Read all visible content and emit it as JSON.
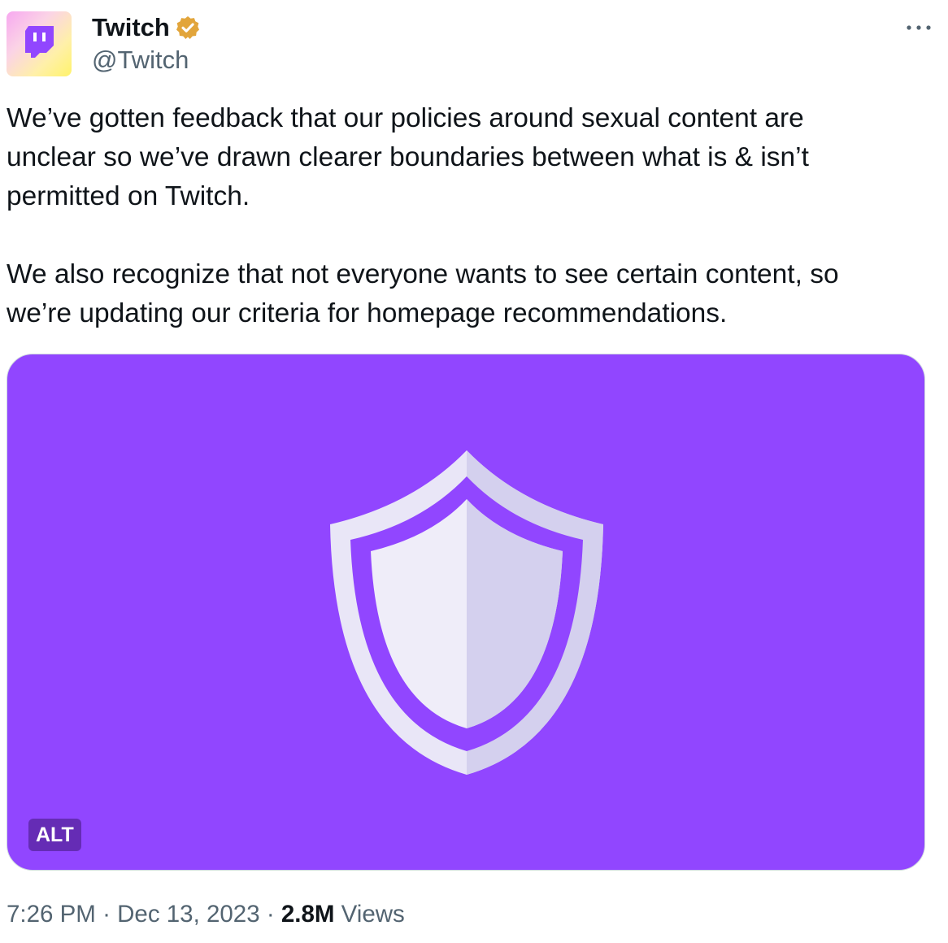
{
  "author": {
    "display_name": "Twitch",
    "handle": "@Twitch",
    "avatar_icon": "twitch-glitch-icon",
    "verified": true,
    "verified_badge_color": "#e2a53b"
  },
  "tweet": {
    "text": "We’ve gotten feedback that our policies around sexual content are\nunclear so we’ve drawn clearer boundaries between what is & isn’t\npermitted on Twitch.\n\nWe also recognize that not everyone wants to see certain content, so\nwe’re updating our criteria for homepage recommendations."
  },
  "media": {
    "background_color": "#9146ff",
    "image_icon": "shield-icon",
    "alt_label": "ALT"
  },
  "meta": {
    "time": "7:26 PM",
    "separator": "·",
    "date": "Dec 13, 2023",
    "views_count": "2.8M",
    "views_label": "Views"
  },
  "actions": {
    "more_icon": "more-horizontal-icon"
  }
}
